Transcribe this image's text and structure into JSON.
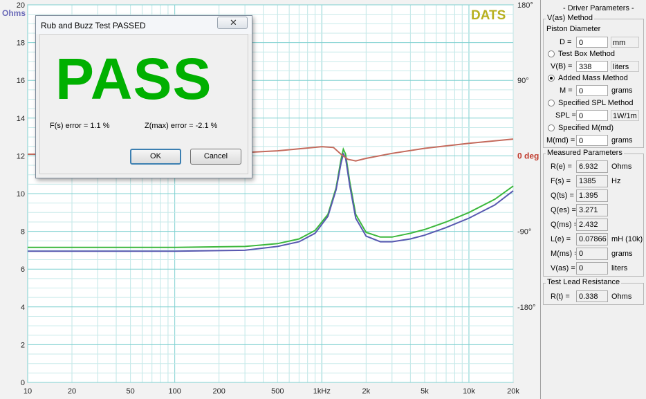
{
  "chart": {
    "left_unit": "Ohms",
    "brand": "DATS",
    "y_ticks_left": [
      "20",
      "18",
      "16",
      "14",
      "12",
      "10",
      "8",
      "6",
      "4",
      "2",
      "0"
    ],
    "phase_ticks": [
      "180°",
      "90°",
      "0 deg",
      "-90°",
      "-180°"
    ],
    "x_ticks": [
      "10",
      "20",
      "50",
      "100",
      "200",
      "500",
      "1kHz",
      "2k",
      "5k",
      "10k",
      "20k"
    ]
  },
  "chart_data": {
    "type": "line",
    "xscale": "log",
    "xlim": [
      10,
      20000
    ],
    "ylim": [
      0,
      20
    ],
    "ylabel": "Ohms",
    "phase_ylim": [
      -270,
      180
    ],
    "series": [
      {
        "role": "impedance_green",
        "color": "#3cb83c",
        "x": [
          10,
          30,
          100,
          300,
          500,
          700,
          900,
          1100,
          1250,
          1350,
          1400,
          1450,
          1550,
          1700,
          2000,
          2500,
          3000,
          4000,
          5000,
          7000,
          10000,
          15000,
          20000
        ],
        "y": [
          7.15,
          7.15,
          7.15,
          7.2,
          7.35,
          7.6,
          8.05,
          8.9,
          10.3,
          11.8,
          12.35,
          12.1,
          10.6,
          8.9,
          7.95,
          7.7,
          7.7,
          7.9,
          8.1,
          8.5,
          9.0,
          9.7,
          10.4
        ]
      },
      {
        "role": "impedance_blue",
        "color": "#5858b0",
        "x": [
          10,
          30,
          100,
          300,
          500,
          700,
          900,
          1100,
          1250,
          1350,
          1400,
          1450,
          1550,
          1700,
          2000,
          2500,
          3000,
          4000,
          5000,
          7000,
          10000,
          15000,
          20000
        ],
        "y": [
          6.95,
          6.95,
          6.95,
          7.0,
          7.2,
          7.45,
          7.9,
          8.8,
          10.2,
          11.6,
          12.1,
          11.9,
          10.4,
          8.7,
          7.75,
          7.45,
          7.45,
          7.6,
          7.8,
          8.2,
          8.7,
          9.4,
          10.15
        ]
      },
      {
        "role": "phase",
        "color": "#c46a5c",
        "x": [
          10,
          50,
          100,
          300,
          500,
          1000,
          1200,
          1350,
          1500,
          1700,
          2000,
          3000,
          5000,
          10000,
          20000
        ],
        "y": [
          2,
          2,
          2,
          4,
          6,
          11,
          10,
          2,
          -4,
          -6,
          -3,
          3,
          9,
          15,
          20
        ]
      }
    ]
  },
  "dialog": {
    "title": "Rub and Buzz Test PASSED",
    "close": "✕",
    "result": "PASS",
    "fs_error": "F(s) error = 1.1 %",
    "zmax_error": "Z(max) error = -2.1 %",
    "ok": "OK",
    "cancel": "Cancel",
    "pass_color": "#00b000"
  },
  "panel": {
    "title": "- Driver Parameters -",
    "vas_group": "V(as) Method",
    "piston_label": "Piston Diameter",
    "d_label": "D =",
    "d_value": "0",
    "d_unit": "mm",
    "testbox_label": "Test Box Method",
    "vb_label": "V(B) =",
    "vb_value": "338",
    "vb_unit": "liters",
    "addedmass_label": "Added Mass Method",
    "m_label": "M =",
    "m_value": "0",
    "m_unit": "grams",
    "spl_method_label": "Specified SPL Method",
    "spl_label": "SPL =",
    "spl_value": "0",
    "spl_unit": "1W/1m",
    "mmd_method_label": "Specified M(md)",
    "mmd_label": "M(md) =",
    "mmd_value": "0",
    "mmd_unit": "grams",
    "measured_group": "Measured Parameters",
    "measured": [
      {
        "label": "R(e) =",
        "value": "6.932",
        "unit": "Ohms"
      },
      {
        "label": "F(s) =",
        "value": "1385",
        "unit": "Hz"
      },
      {
        "label": "Q(ts) =",
        "value": "1.395",
        "unit": ""
      },
      {
        "label": "Q(es) =",
        "value": "3.271",
        "unit": ""
      },
      {
        "label": "Q(ms) =",
        "value": "2.432",
        "unit": ""
      },
      {
        "label": "L(e) =",
        "value": "0.07866",
        "unit": "mH (10k)"
      },
      {
        "label": "M(ms) =",
        "value": "0",
        "unit": "grams"
      },
      {
        "label": "V(as) =",
        "value": "0",
        "unit": "liters"
      }
    ],
    "lead_group": "Test Lead Resistance",
    "rt_label": "R(t) =",
    "rt_value": "0.338",
    "rt_unit": "Ohms"
  }
}
